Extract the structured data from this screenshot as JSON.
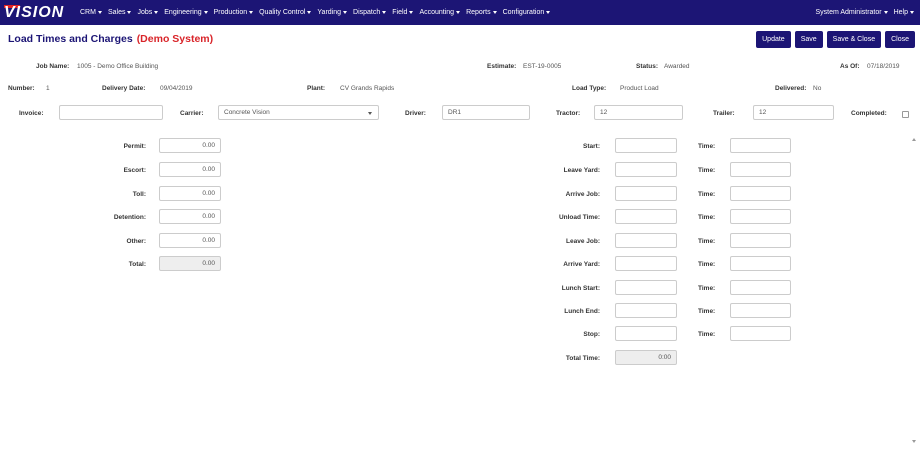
{
  "nav": {
    "logo": "VISION",
    "menu": [
      "CRM",
      "Sales",
      "Jobs",
      "Engineering",
      "Production",
      "Quality Control",
      "Yarding",
      "Dispatch",
      "Field",
      "Accounting",
      "Reports",
      "Configuration"
    ],
    "user": "System Administrator",
    "help": "Help"
  },
  "header": {
    "title": "Load Times and Charges",
    "demo": "(Demo System)",
    "buttons": [
      "Update",
      "Save",
      "Save & Close",
      "Close"
    ]
  },
  "info": {
    "job_name_label": "Job Name:",
    "job_name": "1005 - Demo Office Building",
    "estimate_label": "Estimate:",
    "estimate": "EST-19-0005",
    "status_label": "Status:",
    "status": "Awarded",
    "asof_label": "As Of:",
    "asof": "07/18/2019",
    "number_label": "Number:",
    "number": "1",
    "delivery_label": "Delivery Date:",
    "delivery": "09/04/2019",
    "plant_label": "Plant:",
    "plant": "CV Grands Rapids",
    "load_type_label": "Load Type:",
    "load_type": "Product Load",
    "delivered_label": "Delivered:",
    "delivered": "No"
  },
  "row3": {
    "invoice_label": "Invoice:",
    "invoice": "",
    "carrier_label": "Carrier:",
    "carrier": "Concrete Vision",
    "driver_label": "Driver:",
    "driver": "DR1",
    "tractor_label": "Tractor:",
    "tractor": "12",
    "trailer_label": "Trailer:",
    "trailer": "12",
    "completed_label": "Completed:"
  },
  "charges": [
    {
      "label": "Permit:",
      "value": "0.00"
    },
    {
      "label": "Escort:",
      "value": "0.00"
    },
    {
      "label": "Toll:",
      "value": "0.00"
    },
    {
      "label": "Detention:",
      "value": "0.00"
    },
    {
      "label": "Other:",
      "value": "0.00"
    },
    {
      "label": "Total:",
      "value": "0.00"
    }
  ],
  "times": [
    {
      "label": "Start:",
      "time_label": "Time:"
    },
    {
      "label": "Leave Yard:",
      "time_label": "Time:"
    },
    {
      "label": "Arrive Job:",
      "time_label": "Time:"
    },
    {
      "label": "Unload Time:",
      "time_label": "Time:"
    },
    {
      "label": "Leave Job:",
      "time_label": "Time:"
    },
    {
      "label": "Arrive Yard:",
      "time_label": "Time:"
    },
    {
      "label": "Lunch Start:",
      "time_label": "Time:"
    },
    {
      "label": "Lunch End:",
      "time_label": "Time:"
    },
    {
      "label": "Stop:",
      "time_label": "Time:"
    }
  ],
  "total_time": {
    "label": "Total Time:",
    "value": "0:00"
  },
  "colors": {
    "nav": "#1c1575",
    "demo": "#d9252a",
    "logo_accent": "#e32222"
  }
}
